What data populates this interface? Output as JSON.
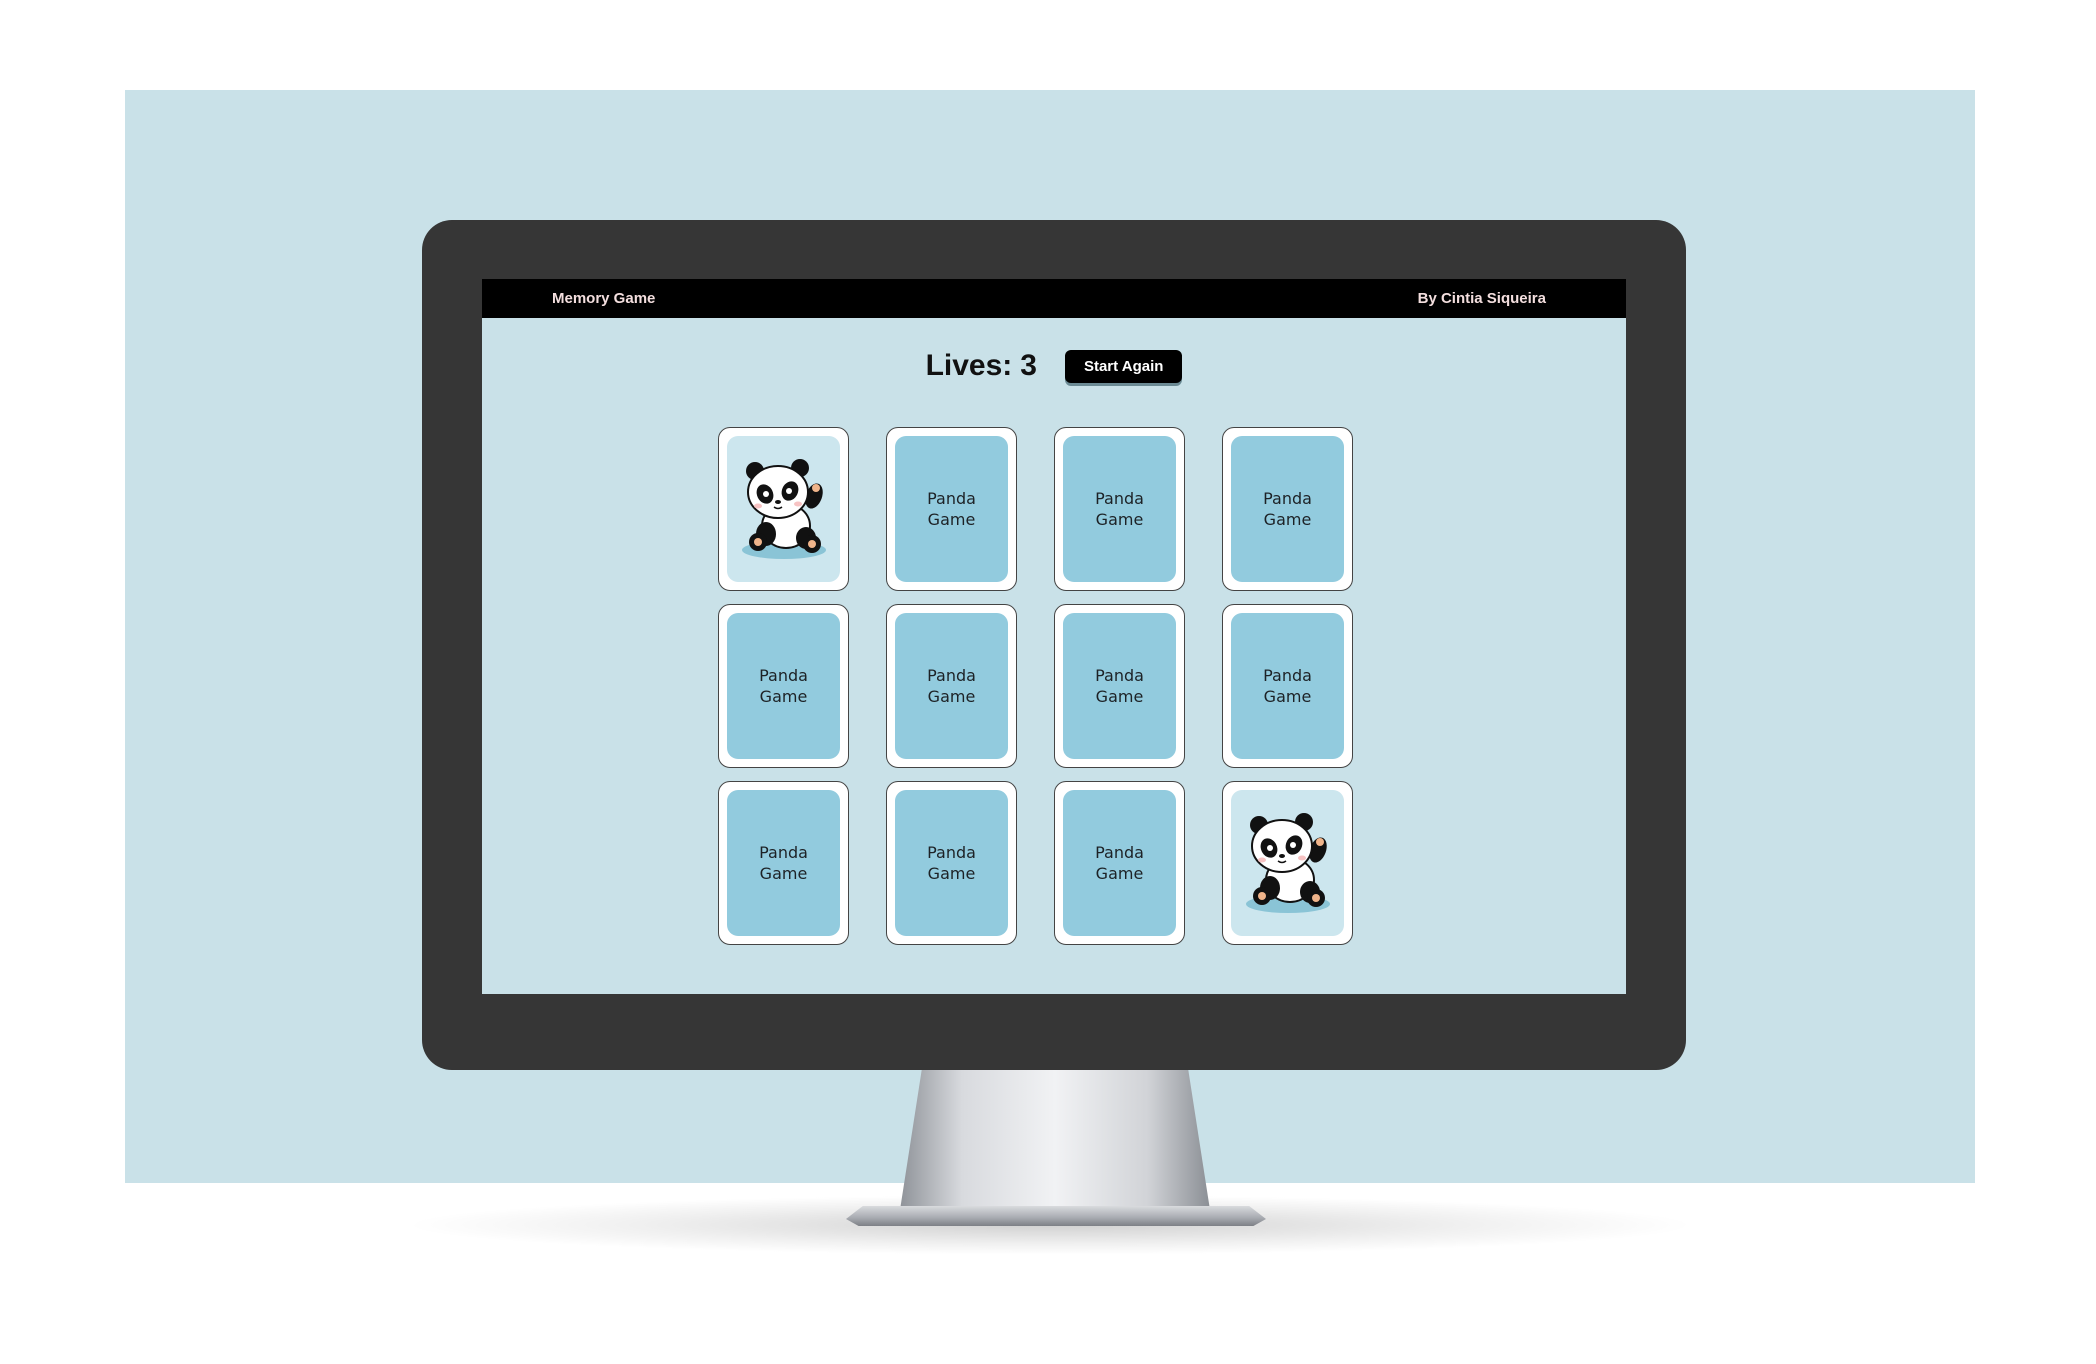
{
  "app": {
    "title": "Memory Game",
    "author": "By Cintia Siqueira"
  },
  "status": {
    "lives_label": "Lives:",
    "lives_value": "3",
    "restart_label": "Start Again"
  },
  "card_back": {
    "line1": "Panda",
    "line2": "Game"
  },
  "cards": [
    {
      "state": "revealed",
      "icon": "panda-icon"
    },
    {
      "state": "hidden"
    },
    {
      "state": "hidden"
    },
    {
      "state": "hidden"
    },
    {
      "state": "hidden"
    },
    {
      "state": "hidden"
    },
    {
      "state": "hidden"
    },
    {
      "state": "hidden"
    },
    {
      "state": "hidden"
    },
    {
      "state": "hidden"
    },
    {
      "state": "hidden"
    },
    {
      "state": "revealed",
      "icon": "panda-icon"
    }
  ],
  "colors": {
    "background": "#c9e1e8",
    "card_back": "#92cbde",
    "navbar": "#000000",
    "monitor_bezel": "#363636"
  }
}
